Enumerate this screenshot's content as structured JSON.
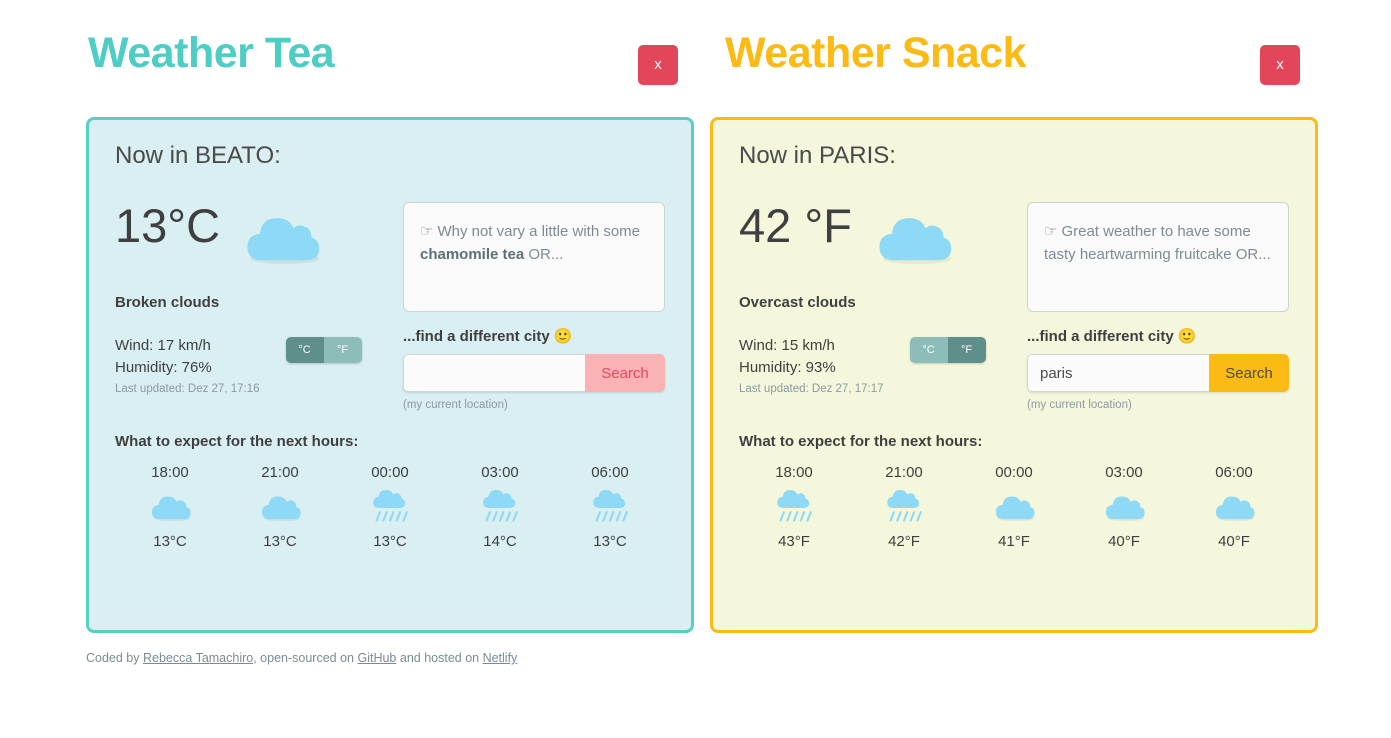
{
  "panes": [
    {
      "id": "weather-tea",
      "title": "Weather Tea",
      "title_color": "#4ecdc4",
      "accent": "#56cfc4",
      "card_bg": "#d9eff1",
      "close_label": "x",
      "close_color": "#e3455a",
      "card_title": "Now in BEATO:",
      "temperature": "13°C",
      "condition_icon": "cloud-icon",
      "description": "Broken clouds",
      "wind": "Wind: 17 km/h",
      "humidity": "Humidity: 76%",
      "last_updated": "Last updated: Dez 27, 17:16",
      "units": {
        "celsius": "°C",
        "fahrenheit": "°F",
        "active": "celsius"
      },
      "suggestion": {
        "icon": "pointing-hand-icon",
        "text_before": "Why not vary a little with some ",
        "highlight": "chamomile tea",
        "text_after": " OR..."
      },
      "find_label": "...find a different city",
      "find_emoji": "🙂",
      "search_value": "",
      "search_placeholder": "",
      "search_button": "Search",
      "search_button_bg": "#fbb2b4",
      "search_button_fg": "#e8485a",
      "current_location": "(my current location)",
      "forecast_title": "What to expect for the next hours:",
      "forecast": [
        {
          "time": "18:00",
          "icon": "cloud-icon",
          "temp": "13°C"
        },
        {
          "time": "21:00",
          "icon": "cloud-icon",
          "temp": "13°C"
        },
        {
          "time": "00:00",
          "icon": "rain-icon",
          "temp": "13°C"
        },
        {
          "time": "03:00",
          "icon": "rain-icon",
          "temp": "14°C"
        },
        {
          "time": "06:00",
          "icon": "rain-icon",
          "temp": "13°C"
        }
      ]
    },
    {
      "id": "weather-snack",
      "title": "Weather Snack",
      "title_color": "#fcba14",
      "accent": "#fcba14",
      "card_bg": "#f5f7dd",
      "close_label": "x",
      "close_color": "#e3455a",
      "card_title": "Now in PARIS:",
      "temperature": "42 °F",
      "condition_icon": "cloud-icon",
      "description": "Overcast clouds",
      "wind": "Wind: 15 km/h",
      "humidity": "Humidity: 93%",
      "last_updated": "Last updated: Dez 27, 17:17",
      "units": {
        "celsius": "°C",
        "fahrenheit": "°F",
        "active": "fahrenheit"
      },
      "suggestion": {
        "icon": "pointing-hand-icon",
        "text_before": "Great weather to have some tasty heartwarming fruitcake OR...",
        "highlight": "",
        "text_after": ""
      },
      "find_label": "...find a different city",
      "find_emoji": "🙂",
      "search_value": "paris",
      "search_placeholder": "",
      "search_button": "Search",
      "search_button_bg": "#fcba14",
      "search_button_fg": "#4a4a4a",
      "current_location": "(my current location)",
      "forecast_title": "What to expect for the next hours:",
      "forecast": [
        {
          "time": "18:00",
          "icon": "rain-icon",
          "temp": "43°F"
        },
        {
          "time": "21:00",
          "icon": "rain-icon",
          "temp": "42°F"
        },
        {
          "time": "00:00",
          "icon": "cloud-icon",
          "temp": "41°F"
        },
        {
          "time": "03:00",
          "icon": "cloud-icon",
          "temp": "40°F"
        },
        {
          "time": "06:00",
          "icon": "cloud-icon",
          "temp": "40°F"
        }
      ]
    }
  ],
  "footer": {
    "prefix": "Coded by ",
    "author": "Rebecca Tamachiro",
    "middle": ", open-sourced on ",
    "repo": "GitHub",
    "middle2": " and hosted on ",
    "host": "Netlify"
  }
}
